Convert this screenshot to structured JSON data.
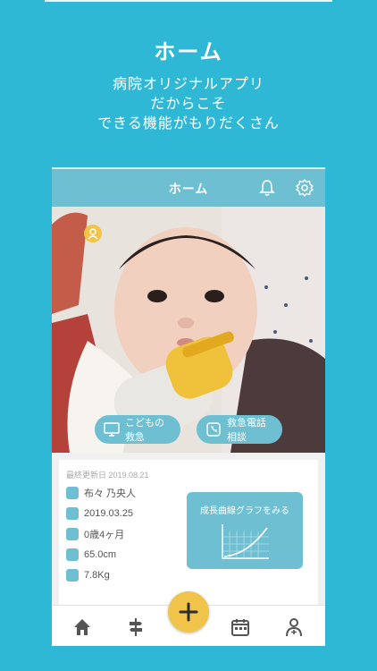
{
  "promo": {
    "title": "ホーム",
    "subtitle_lines": [
      "病院オリジナルアプリ",
      "だからこそ",
      "できる機能がもりだくさん"
    ]
  },
  "app": {
    "header": {
      "title": "ホーム",
      "bell_icon": "bell-icon",
      "settings_icon": "gear-icon"
    },
    "photo": {
      "buttons": [
        {
          "label": "こどもの救急",
          "icon": "monitor-icon"
        },
        {
          "label": "救急電話相談",
          "icon": "phone-icon"
        }
      ]
    },
    "profile": {
      "last_updated": "最終更新日 2019.08.21",
      "rows": [
        {
          "icon": "child-icon",
          "value": "布々 乃央人"
        },
        {
          "icon": "cake-icon",
          "value": "2019.03.25"
        },
        {
          "icon": "age-icon",
          "value": "0歳4ヶ月"
        },
        {
          "icon": "height-icon",
          "value": "65.0cm"
        },
        {
          "icon": "weight-icon",
          "value": "7.8Kg"
        }
      ],
      "growth_button": "成長曲線グラフをみる"
    },
    "tabbar": [
      {
        "name": "home-icon"
      },
      {
        "name": "signpost-icon"
      },
      {
        "name": "add-icon"
      },
      {
        "name": "calendar-icon"
      },
      {
        "name": "doctor-icon"
      }
    ]
  },
  "colors": {
    "background": "#2fb8d6",
    "accent": "#6fbfd2",
    "fab": "#f0c34a"
  }
}
